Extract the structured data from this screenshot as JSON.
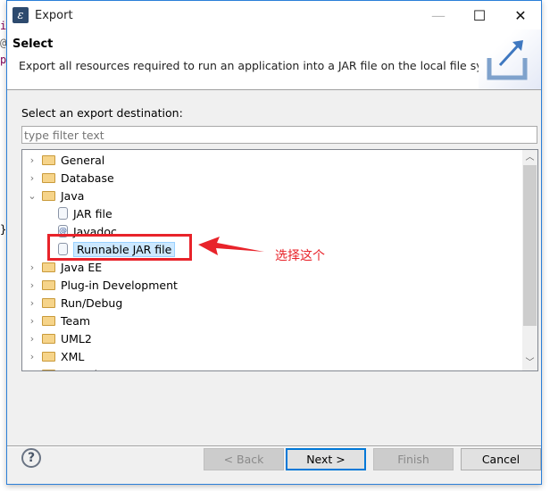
{
  "background_fragments": [
    "i",
    "@",
    "p",
    "}"
  ],
  "window": {
    "title": "Export",
    "app_icon": "eclipse-icon",
    "controls": {
      "minimize": "—",
      "maximize": "☐",
      "close": "✕"
    }
  },
  "header": {
    "title": "Select",
    "description": "Export all resources required to run an application into a JAR file on the local file system.",
    "banner_icon": "export-icon"
  },
  "body": {
    "label": "Select an export destination:",
    "filter": {
      "value": "",
      "placeholder": "type filter text"
    },
    "tree": [
      {
        "label": "General",
        "type": "folder",
        "expanded": false
      },
      {
        "label": "Database",
        "type": "folder",
        "expanded": false
      },
      {
        "label": "Java",
        "type": "folder",
        "expanded": true
      },
      {
        "label": "JAR file",
        "type": "jar",
        "child": true
      },
      {
        "label": "Javadoc",
        "type": "javadoc",
        "child": true
      },
      {
        "label": "Runnable JAR file",
        "type": "runnable-jar",
        "child": true,
        "selected": true
      },
      {
        "label": "Java EE",
        "type": "folder",
        "expanded": false
      },
      {
        "label": "Plug-in Development",
        "type": "folder",
        "expanded": false
      },
      {
        "label": "Run/Debug",
        "type": "folder",
        "expanded": false
      },
      {
        "label": "Team",
        "type": "folder",
        "expanded": false
      },
      {
        "label": "UML2",
        "type": "folder",
        "expanded": false
      },
      {
        "label": "XML",
        "type": "folder",
        "expanded": false
      },
      {
        "label": "Oomph",
        "type": "folder",
        "expanded": true
      }
    ]
  },
  "annotation": {
    "text": "选择这个",
    "color": "#e8232a"
  },
  "footer": {
    "back": "< Back",
    "next": "Next >",
    "finish": "Finish",
    "cancel": "Cancel"
  }
}
